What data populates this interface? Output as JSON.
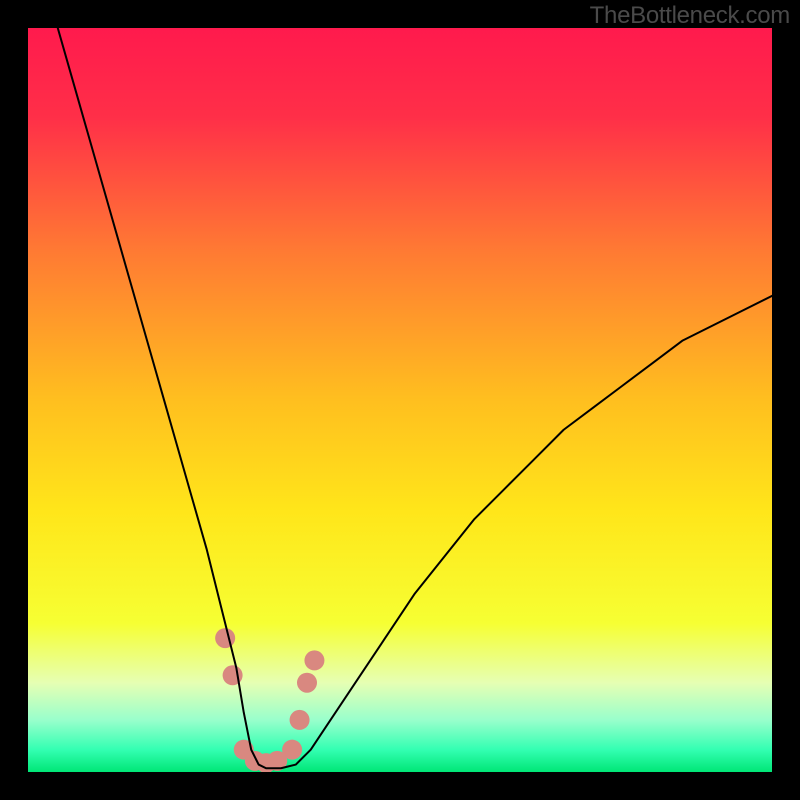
{
  "watermark": "TheBottleneck.com",
  "chart_data": {
    "type": "line",
    "title": "",
    "xlabel": "",
    "ylabel": "",
    "xlim": [
      0,
      100
    ],
    "ylim": [
      0,
      100
    ],
    "background_gradient": {
      "stops": [
        {
          "offset": 0.0,
          "color": "#ff1a4d"
        },
        {
          "offset": 0.12,
          "color": "#ff2f48"
        },
        {
          "offset": 0.3,
          "color": "#ff7a33"
        },
        {
          "offset": 0.5,
          "color": "#ffbf1f"
        },
        {
          "offset": 0.65,
          "color": "#ffe61a"
        },
        {
          "offset": 0.8,
          "color": "#f6ff33"
        },
        {
          "offset": 0.88,
          "color": "#e6ffb3"
        },
        {
          "offset": 0.93,
          "color": "#99ffcc"
        },
        {
          "offset": 0.97,
          "color": "#33ffb2"
        },
        {
          "offset": 1.0,
          "color": "#00e676"
        }
      ]
    },
    "series": [
      {
        "name": "bottleneck-curve",
        "color": "#000000",
        "stroke_width": 2,
        "x": [
          4,
          6,
          8,
          10,
          12,
          14,
          16,
          18,
          20,
          22,
          24,
          26,
          28,
          29,
          30,
          31,
          32,
          34,
          36,
          38,
          40,
          44,
          48,
          52,
          56,
          60,
          64,
          68,
          72,
          76,
          80,
          84,
          88,
          92,
          96,
          100
        ],
        "y": [
          100,
          93,
          86,
          79,
          72,
          65,
          58,
          51,
          44,
          37,
          30,
          22,
          14,
          8,
          3,
          1,
          0.5,
          0.5,
          1,
          3,
          6,
          12,
          18,
          24,
          29,
          34,
          38,
          42,
          46,
          49,
          52,
          55,
          58,
          60,
          62,
          64
        ]
      }
    ],
    "markers": {
      "name": "highlight-dots",
      "color": "#d98880",
      "radius": 10,
      "points": [
        {
          "x": 26.5,
          "y": 18
        },
        {
          "x": 27.5,
          "y": 13
        },
        {
          "x": 29.0,
          "y": 3.0
        },
        {
          "x": 30.5,
          "y": 1.5
        },
        {
          "x": 32.0,
          "y": 1.2
        },
        {
          "x": 33.5,
          "y": 1.5
        },
        {
          "x": 35.5,
          "y": 3.0
        },
        {
          "x": 36.5,
          "y": 7
        },
        {
          "x": 37.5,
          "y": 12
        },
        {
          "x": 38.5,
          "y": 15
        }
      ]
    }
  }
}
